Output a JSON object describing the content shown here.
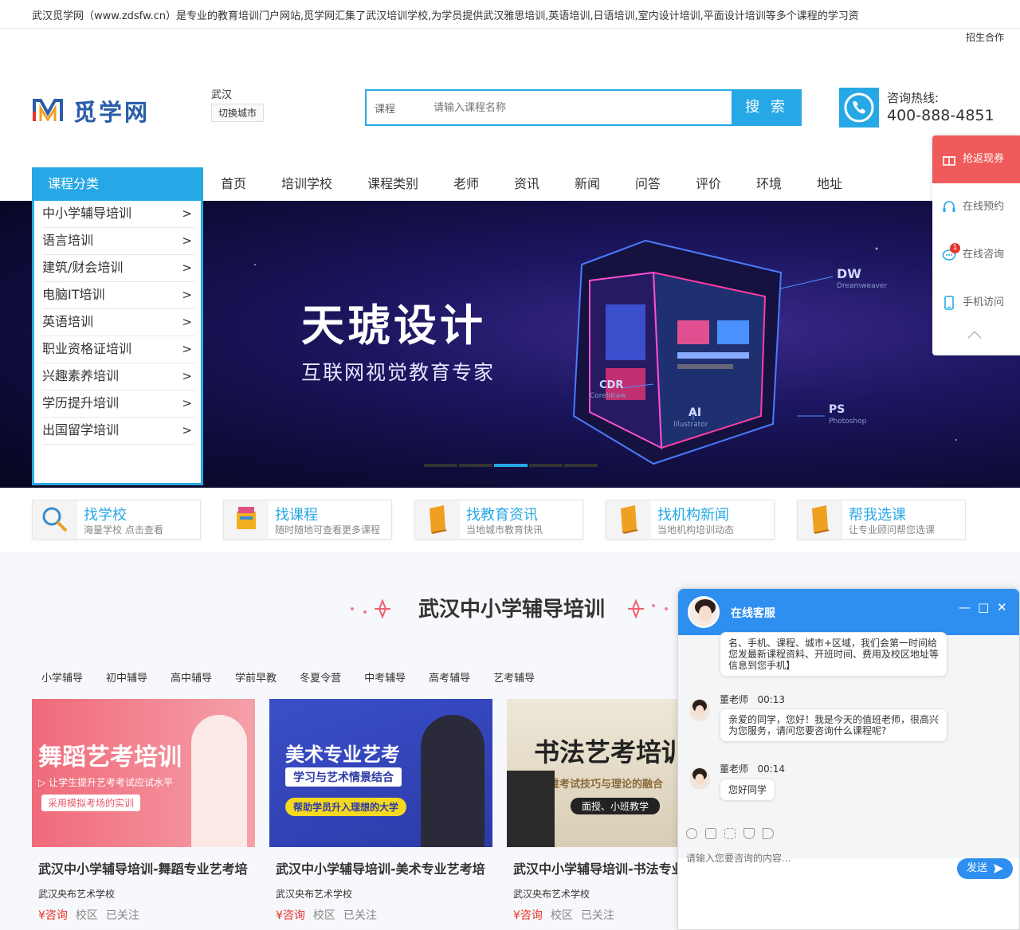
{
  "topbar": {
    "intro": "武汉觅学网（www.zdsfw.cn）是专业的教育培训门户网站,觅学网汇集了武汉培训学校,为学员提供武汉雅思培训,英语培训,日语培训,室内设计培训,平面设计培训等多个课程的学习资",
    "coop": "招生合作"
  },
  "header": {
    "logo_text": "觅学网",
    "city": "武汉",
    "switch_city": "切换城市",
    "search_category": "课程",
    "search_placeholder": "请输入课程名称",
    "search_button": "搜 索",
    "hotline_label": "咨询热线:",
    "hotline_number": "400-888-4851"
  },
  "nav": {
    "category_head": "课程分类",
    "items": [
      "首页",
      "培训学校",
      "课程类别",
      "老师",
      "资讯",
      "新闻",
      "问答",
      "评价",
      "环境",
      "地址"
    ]
  },
  "categories": [
    "中小学辅导培训",
    "语言培训",
    "建筑/财会培训",
    "电脑IT培训",
    "英语培训",
    "职业资格证培训",
    "兴趣素养培训",
    "学历提升培训",
    "出国留学培训"
  ],
  "category_arrow": ">",
  "banner": {
    "title": "天琥设计",
    "subtitle": "互联网视觉教育专家",
    "labels": [
      "DW",
      "Dreamweaver",
      "CDR",
      "Coreldraw",
      "AI",
      "Illustrator",
      "PS",
      "Photoshop"
    ],
    "active_dot": 2
  },
  "features": [
    {
      "title": "找学校",
      "desc": "海量学校 点击查看"
    },
    {
      "title": "找课程",
      "desc": "随时随地可查看更多课程"
    },
    {
      "title": "找教育资讯",
      "desc": "当地城市教育快讯"
    },
    {
      "title": "找机构新闻",
      "desc": "当地机构培训动态"
    },
    {
      "title": "帮我选课",
      "desc": "让专业顾问帮您选课"
    }
  ],
  "section": {
    "heading": "武汉中小学辅导培训",
    "tabs": [
      "小学辅导",
      "初中辅导",
      "高中辅导",
      "学前早教",
      "冬夏令营",
      "中考辅导",
      "高考辅导",
      "艺考辅导"
    ]
  },
  "cards": [
    {
      "img_title": "舞蹈艺考培训",
      "img_sub": "▷ 让学生提升艺考考试应试水平",
      "img_tag": "采用模拟考场的实训",
      "title": "武汉中小学辅导培训-舞蹈专业艺考培",
      "school": "武汉央布艺术学校",
      "price": "¥咨询",
      "campus": "校区",
      "follow": "已关注"
    },
    {
      "img_title": "美术专业艺考",
      "img_sub": "学习与艺术情景结合",
      "img_tag": "帮助学员升入理想的大学",
      "title": "武汉中小学辅导培训-美术专业艺考培",
      "school": "武汉央布艺术学校",
      "price": "¥咨询",
      "campus": "校区",
      "follow": "已关注"
    },
    {
      "img_title": "书法艺考培训",
      "img_sub": "注重考试技巧与理论的融合",
      "img_tag": "面授、小班教学",
      "title": "武汉中小学辅导培训-书法专业",
      "school": "武汉央布艺术学校",
      "price": "¥咨询",
      "campus": "校区",
      "follow": "已关注"
    }
  ],
  "right_float": {
    "top": "抢返现券",
    "items": [
      "在线预约",
      "在线咨询",
      "手机访问"
    ],
    "badge": "1"
  },
  "chat": {
    "title": "在线客服",
    "controls": [
      "—",
      "□",
      "✕"
    ],
    "messages": [
      {
        "text": "名、手机、课程、城市+区域，我们会第一时间给您发最新课程资料、开班时间、费用及校区地址等信息到您手机】"
      },
      {
        "sender": "董老师",
        "time": "00:13",
        "text": "亲爱的同学，您好！我是今天的值班老师，很高兴为您服务，请问您要咨询什么课程呢?"
      },
      {
        "sender": "董老师",
        "time": "00:14",
        "text": "您好同学"
      }
    ],
    "input_placeholder": "请输入您要咨询的内容...",
    "send": "发送"
  },
  "colors": {
    "accent": "#27a8e6",
    "chat_blue": "#2e8ff0",
    "red": "#e8342c",
    "coupon": "#f05a5a"
  }
}
